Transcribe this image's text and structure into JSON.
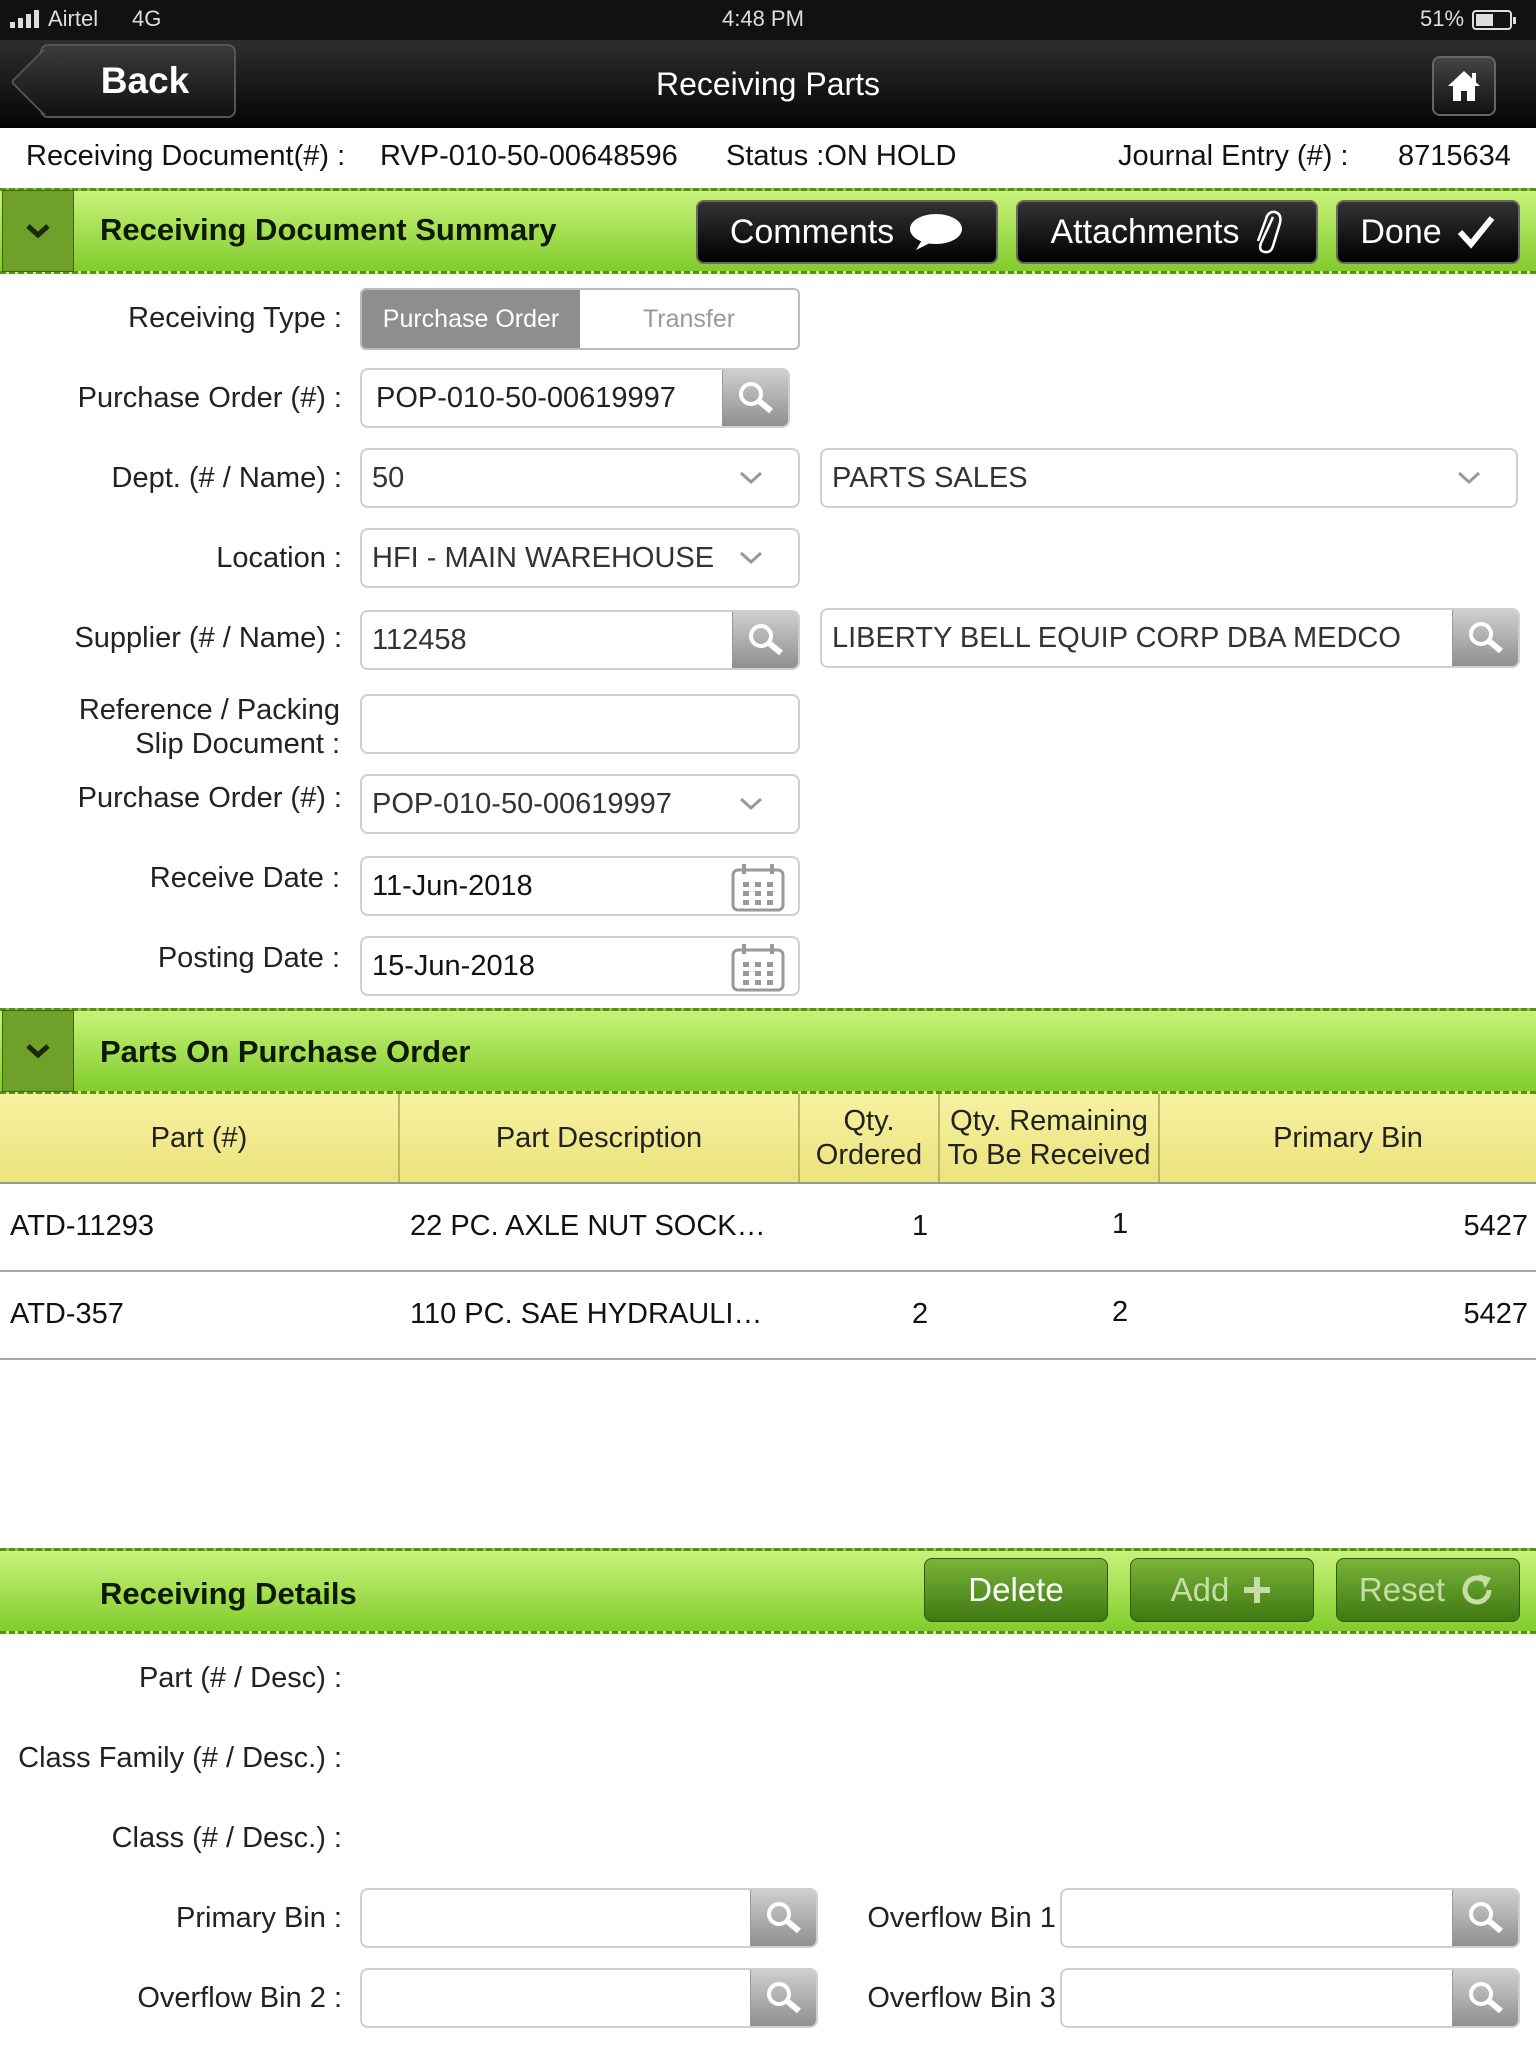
{
  "status_bar": {
    "carrier": "Airtel",
    "network": "4G",
    "time": "4:48 PM",
    "battery": "51%"
  },
  "nav": {
    "back_label": "Back",
    "title": "Receiving Parts"
  },
  "info": {
    "doc_label": "Receiving Document(#) :",
    "doc_value": "RVP-010-50-00648596",
    "status_text": "Status :ON HOLD",
    "journal_label": "Journal Entry (#) :",
    "journal_value": "8715634"
  },
  "summary": {
    "title": "Receiving Document Summary",
    "comments_label": "Comments",
    "attachments_label": "Attachments",
    "done_label": "Done"
  },
  "form": {
    "receiving_type_label": "Receiving Type  :",
    "type_options": [
      "Purchase Order",
      "Transfer"
    ],
    "po_label": "Purchase Order (#)  :",
    "po_value": "POP-010-50-00619997",
    "dept_label": "Dept. (# / Name)  :",
    "dept_number": "50",
    "dept_name": "PARTS SALES",
    "location_label": "Location  :",
    "location_value": "HFI - MAIN WAREHOUSE",
    "supplier_label": "Supplier (# / Name)  :",
    "supplier_number": "112458",
    "supplier_name": "LIBERTY BELL EQUIP CORP DBA MEDCO",
    "reference_label_1": "Reference / Packing",
    "reference_label_2": "Slip Document :",
    "reference_value": "",
    "po2_label": "Purchase Order (#)  :",
    "po2_value": "POP-010-50-00619997",
    "receive_date_label": "Receive Date :",
    "receive_date": "11-Jun-2018",
    "posting_date_label": "Posting Date :",
    "posting_date": "15-Jun-2018"
  },
  "parts": {
    "title": "Parts On Purchase Order",
    "columns": [
      "Part (#)",
      "Part Description",
      "Qty. Ordered",
      "Qty. Remaining To Be Received",
      "Primary Bin"
    ],
    "rows": [
      {
        "part": "ATD-11293",
        "desc": "22 PC. AXLE NUT SOCK…",
        "ordered": "1",
        "remaining": "1",
        "bin": "5427"
      },
      {
        "part": "ATD-357",
        "desc": "110 PC. SAE HYDRAULI…",
        "ordered": "2",
        "remaining": "2",
        "bin": "5427"
      }
    ]
  },
  "details": {
    "title": "Receiving Details",
    "delete_label": "Delete",
    "add_label": "Add",
    "reset_label": "Reset",
    "part_label": "Part (# / Desc)  :",
    "class_family_label": "Class Family (# / Desc.) :",
    "class_label": "Class (# / Desc.) :",
    "primary_bin_label": "Primary Bin :",
    "overflow1_label": "Overflow Bin 1 :",
    "overflow2_label": "Overflow Bin 2 :",
    "overflow3_label": "Overflow Bin 3 :"
  },
  "colors": {
    "accent_green": "#82cc2c",
    "header_black": "#111111",
    "table_header": "#f0e98c"
  }
}
